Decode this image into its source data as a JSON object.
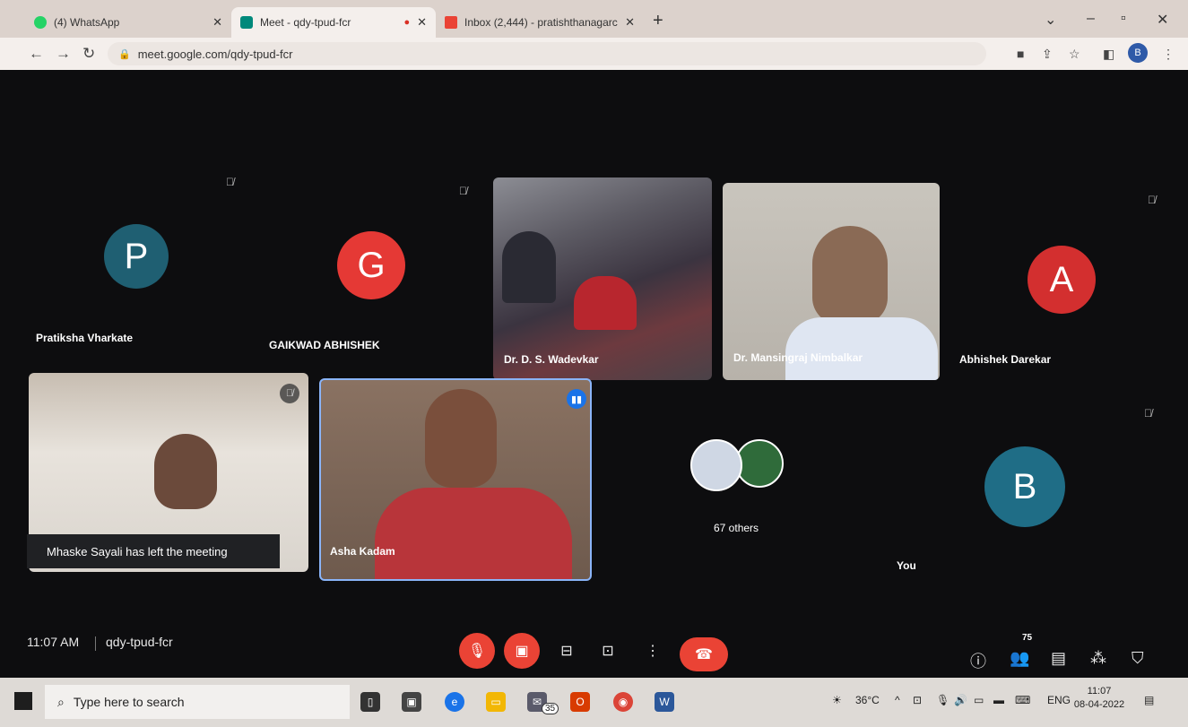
{
  "browser": {
    "tabs": [
      {
        "title": "(4) WhatsApp",
        "favicon_color": "#25d366"
      },
      {
        "title": "Meet - qdy-tpud-fcr",
        "favicon_color": "#00897b",
        "recording": true
      },
      {
        "title": "Inbox (2,444) - pratishthanagarc",
        "favicon_color": "#ea4335"
      }
    ],
    "url": "meet.google.com/qdy-tpud-fcr",
    "profile_initial": "B"
  },
  "meet": {
    "participants": [
      {
        "name": "Pratiksha Vharkate",
        "initial": "P",
        "color": "#1f5f72"
      },
      {
        "name": "GAIKWAD ABHISHEK",
        "initial": "G",
        "color": "#e53935"
      },
      {
        "name": "Dr. D. S. Wadevkar"
      },
      {
        "name": "Dr. Mansingraj Nimbalkar"
      },
      {
        "name": "Abhishek Darekar",
        "initial": "A",
        "color": "#d32f2f"
      },
      {
        "name": "Asha Kadam"
      },
      {
        "name": "You",
        "initial": "B",
        "color": "#1f6d86"
      }
    ],
    "left_notice": "Mhaske Sayali has left the meeting",
    "others_label": "67 others",
    "time": "11:07 AM",
    "meeting_code": "qdy-tpud-fcr",
    "people_count": "75"
  },
  "taskbar": {
    "search_placeholder": "Type here to search",
    "mail_badge": "35",
    "weather": "36°C",
    "language": "ENG",
    "time": "11:07",
    "date": "08-04-2022"
  }
}
